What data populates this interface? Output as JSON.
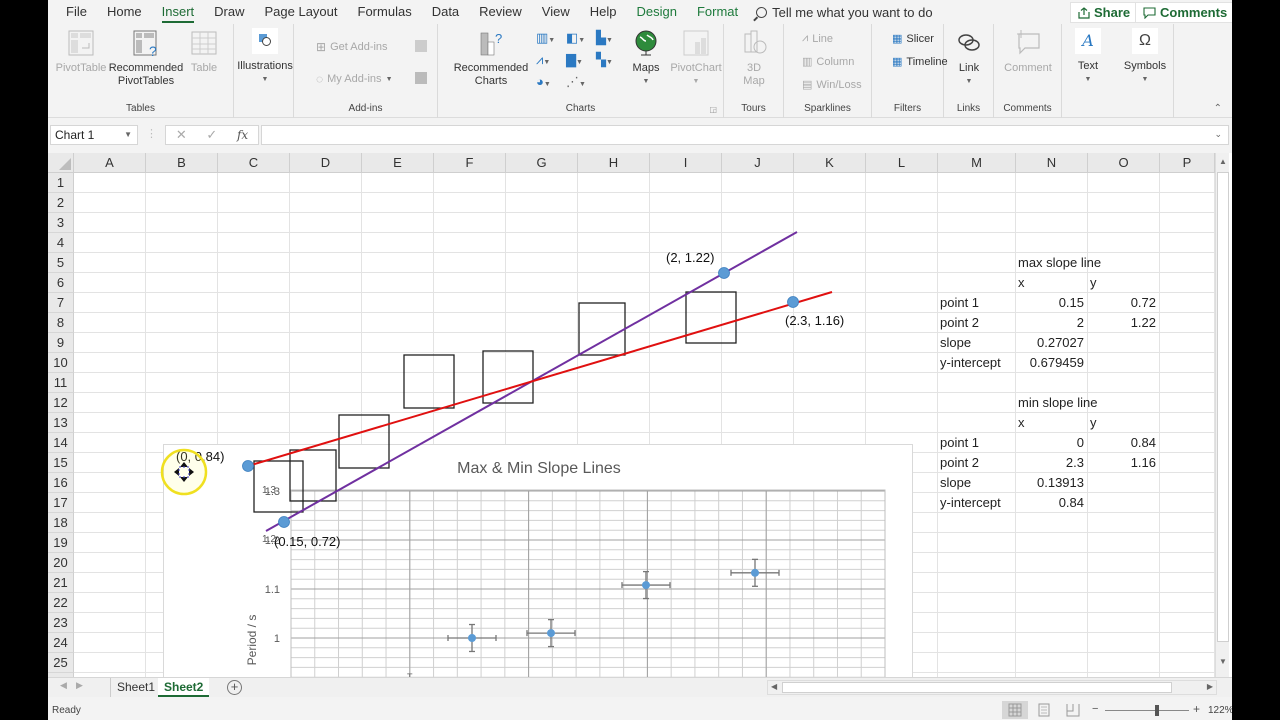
{
  "ribbon_tabs": [
    "File",
    "Home",
    "Insert",
    "Draw",
    "Page Layout",
    "Formulas",
    "Data",
    "Review",
    "View",
    "Help",
    "Design",
    "Format"
  ],
  "active_tab": "Insert",
  "tell_me": "Tell me what you want to do",
  "share_label": "Share",
  "comments_label": "Comments",
  "ribbon": {
    "tables": {
      "label": "Tables",
      "pivottable": "PivotTable",
      "recommended_pivottables_1": "Recommended",
      "recommended_pivottables_2": "PivotTables",
      "table": "Table"
    },
    "illustrations": {
      "label": "Illustrations"
    },
    "addins": {
      "label": "Add-ins",
      "get": "Get Add-ins",
      "my": "My Add-ins"
    },
    "charts": {
      "label": "Charts",
      "recommended_1": "Recommended",
      "recommended_2": "Charts",
      "maps": "Maps",
      "pivotchart": "PivotChart"
    },
    "tours": {
      "label": "Tours",
      "map_1": "3D",
      "map_2": "Map"
    },
    "sparklines": {
      "label": "Sparklines",
      "line": "Line",
      "column": "Column",
      "winloss": "Win/Loss"
    },
    "filters": {
      "label": "Filters",
      "slicer": "Slicer",
      "timeline": "Timeline"
    },
    "links": {
      "label": "Links",
      "link": "Link"
    },
    "comments": {
      "label": "Comments",
      "comment": "Comment"
    },
    "text": {
      "label": "Text"
    },
    "symbols": {
      "label": "Symbols"
    }
  },
  "name_box": "Chart 1",
  "formula_value": "",
  "columns": [
    "A",
    "B",
    "C",
    "D",
    "E",
    "F",
    "G",
    "H",
    "I",
    "J",
    "K",
    "L",
    "M",
    "N",
    "O",
    "P"
  ],
  "rows": [
    "1",
    "2",
    "3",
    "4",
    "5",
    "6",
    "7",
    "8",
    "9",
    "10",
    "11",
    "12",
    "13",
    "14",
    "15",
    "16",
    "17",
    "18",
    "19",
    "20",
    "21",
    "22",
    "23",
    "24",
    "25"
  ],
  "table": {
    "max": {
      "title": "max slope line",
      "x_hdr": "x",
      "y_hdr": "y",
      "rows": [
        {
          "label": "point 1",
          "x": "0.15",
          "y": "0.72"
        },
        {
          "label": "point 2",
          "x": "2",
          "y": "1.22"
        },
        {
          "label": "slope",
          "x": "0.27027",
          "y": ""
        },
        {
          "label": "y-intercept",
          "x": "0.679459",
          "y": ""
        }
      ]
    },
    "min": {
      "title": "min slope line",
      "x_hdr": "x",
      "y_hdr": "y",
      "rows": [
        {
          "label": "point 1",
          "x": "0",
          "y": "0.84"
        },
        {
          "label": "point 2",
          "x": "2.3",
          "y": "1.16"
        },
        {
          "label": "slope",
          "x": "0.13913",
          "y": ""
        },
        {
          "label": "y-intercept",
          "x": "0.84",
          "y": ""
        }
      ]
    }
  },
  "annotations": {
    "max_p1": "(0.15, 0.72)",
    "max_p2": "(2, 1.22)",
    "min_p1": "(0, 0.84)",
    "min_p2": "(2.3, 1.16)"
  },
  "colors": {
    "max_line": "#7030a0",
    "min_line": "#e01010",
    "point": "#5b9bd5",
    "accent": "#1e6b35"
  },
  "chart_data": {
    "type": "scatter",
    "title": "Max & Min Slope Lines",
    "xlabel": "",
    "ylabel": "Period / s",
    "yticks": [
      "1",
      "1.1",
      "1.2",
      "1.3"
    ],
    "ylim_visible": [
      0.92,
      1.3
    ],
    "grid": true,
    "series": [
      {
        "name": "Period",
        "points": [
          {
            "y": 1.0,
            "yerr": 0.055,
            "xerr_rel": 1
          },
          {
            "y": 1.01,
            "yerr": 0.055,
            "xerr_rel": 1
          },
          {
            "y": 1.108,
            "yerr": 0.055,
            "xerr_rel": 1
          },
          {
            "y": 1.133,
            "yerr": 0.055,
            "xerr_rel": 1
          }
        ]
      }
    ]
  },
  "sheets": [
    "Sheet1",
    "Sheet2"
  ],
  "active_sheet": "Sheet2",
  "status": "Ready",
  "zoom": "122%"
}
